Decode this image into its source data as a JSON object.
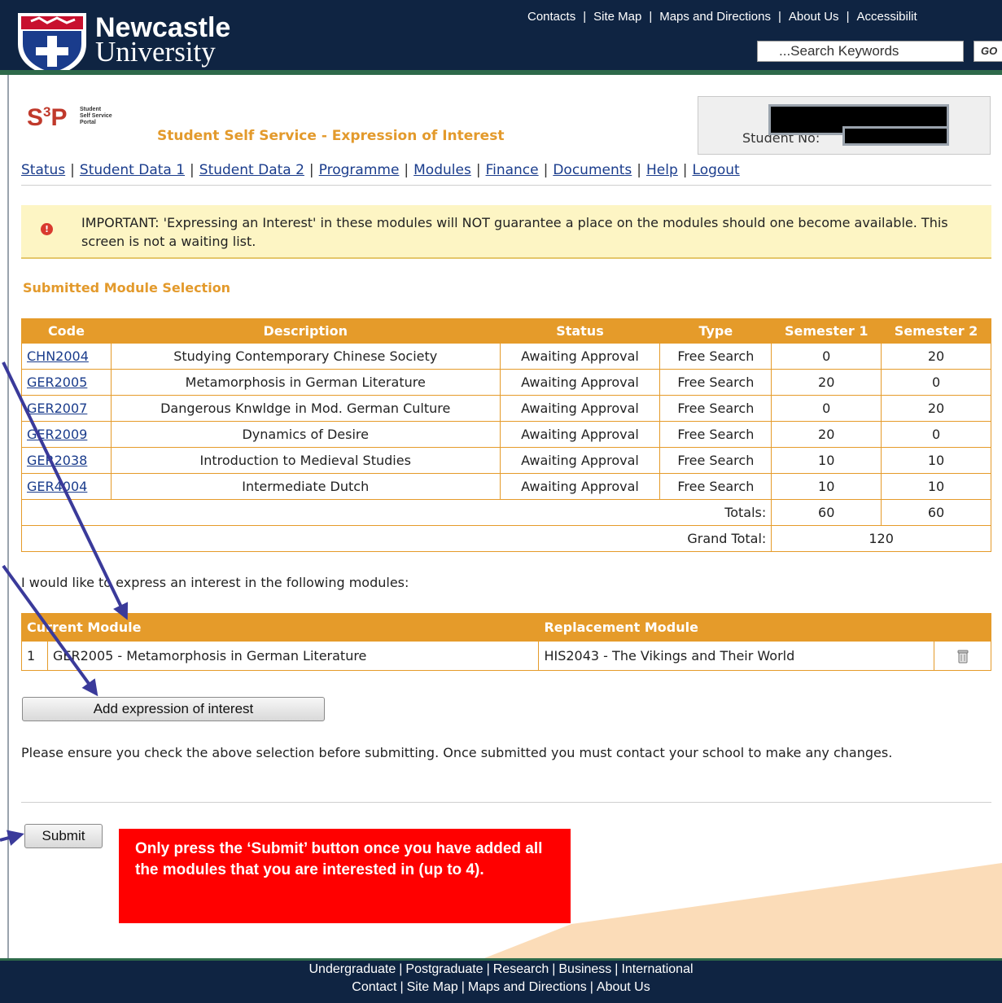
{
  "header": {
    "logo_line1": "Newcastle",
    "logo_line2": "University",
    "top_links": [
      "Contacts",
      "Site Map",
      "Maps and Directions",
      "About Us",
      "Accessibilit"
    ],
    "search_placeholder": "...Search Keywords",
    "go_label": "GO"
  },
  "portal": {
    "logo": "S",
    "logo_sup": "3",
    "logo_tail": "P",
    "logo_small": [
      "Student",
      "Self Service",
      "Portal"
    ],
    "heading": "Student Self Service - Expression of Interest",
    "student_label": "Student No:"
  },
  "nav": {
    "items": [
      "Status",
      "Student Data 1",
      "Student Data 2",
      "Programme",
      "Modules",
      "Finance",
      "Documents",
      "Help",
      "Logout"
    ]
  },
  "alert": {
    "text": "IMPORTANT: 'Expressing an Interest' in these modules will NOT guarantee a place on the modules should one become available. This screen is not a waiting list."
  },
  "submitted": {
    "heading": "Submitted Module Selection",
    "columns": [
      "Code",
      "Description",
      "Status",
      "Type",
      "Semester 1",
      "Semester 2"
    ],
    "rows": [
      {
        "code": "CHN2004",
        "description": "Studying Contemporary Chinese Society",
        "status": "Awaiting Approval",
        "type": "Free Search",
        "sem1": "0",
        "sem2": "20"
      },
      {
        "code": "GER2005",
        "description": "Metamorphosis in German Literature",
        "status": "Awaiting Approval",
        "type": "Free Search",
        "sem1": "20",
        "sem2": "0"
      },
      {
        "code": "GER2007",
        "description": "Dangerous Knwldge in Mod. German Culture",
        "status": "Awaiting Approval",
        "type": "Free Search",
        "sem1": "0",
        "sem2": "20"
      },
      {
        "code": "GER2009",
        "description": "Dynamics of Desire",
        "status": "Awaiting Approval",
        "type": "Free Search",
        "sem1": "20",
        "sem2": "0"
      },
      {
        "code": "GER2038",
        "description": "Introduction to Medieval Studies",
        "status": "Awaiting Approval",
        "type": "Free Search",
        "sem1": "10",
        "sem2": "10"
      },
      {
        "code": "GER4004",
        "description": "Intermediate Dutch",
        "status": "Awaiting Approval",
        "type": "Free Search",
        "sem1": "10",
        "sem2": "10"
      }
    ],
    "totals_label": "Totals:",
    "totals_sem1": "60",
    "totals_sem2": "60",
    "grand_total_label": "Grand Total:",
    "grand_total": "120"
  },
  "interest": {
    "intro": "I would like to express an interest in the following modules:",
    "col_current": "Current Module",
    "col_replacement": "Replacement Module",
    "rows": [
      {
        "num": "1",
        "current": "GER2005 - Metamorphosis in German Literature",
        "replacement": "HIS2043 - The Vikings and Their World"
      }
    ],
    "add_button": "Add expression of interest"
  },
  "ensure_text": "Please ensure you check the above selection before submitting. Once submitted you must contact your school to make any changes.",
  "submit_button": "Submit",
  "note": "Only press the ‘Submit’ button once you have added all the modules that you are interested in (up to 4).",
  "footer": {
    "row1": [
      "Undergraduate",
      "Postgraduate",
      "Research",
      "Business",
      "International"
    ],
    "row2": [
      "Contact",
      "Site Map",
      "Maps and Directions",
      "About Us"
    ]
  },
  "colors": {
    "header_bg": "#0f2442",
    "accent_orange": "#e59b2a",
    "alert_bg": "#fdf5c4",
    "note_red": "#ff0000",
    "arrow": "#3a3a9a"
  }
}
